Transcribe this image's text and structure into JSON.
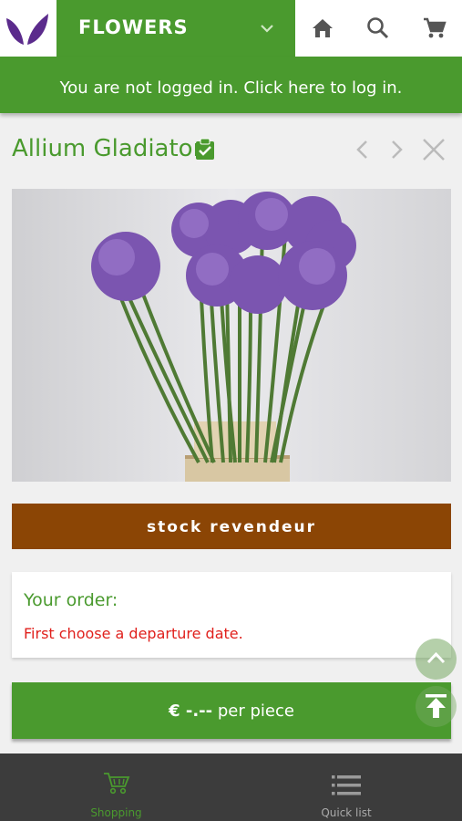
{
  "header": {
    "category_label": "FLOWERS",
    "icons": [
      "home-icon",
      "search-icon",
      "cart-icon"
    ]
  },
  "login_banner": {
    "text": "You are not logged in. Click here to log in."
  },
  "product": {
    "name": "Allium Gladiator",
    "badge_icon": "verified-clipboard-icon",
    "stock_label": "stock revendeur"
  },
  "order": {
    "heading": "Your order:",
    "message": "First choose a departure date."
  },
  "price": {
    "amount": "€ -.--",
    "unit": " per piece"
  },
  "bottom_nav": {
    "items": [
      {
        "label": "Shopping",
        "icon": "cart-outline-icon",
        "active": true
      },
      {
        "label": "Quick list",
        "icon": "list-icon",
        "active": false
      }
    ]
  },
  "colors": {
    "brand_green": "#4a9a2e",
    "stock_brown": "#8b4505",
    "error_red": "#e0201c",
    "logo_purple": "#5b2b8c"
  }
}
